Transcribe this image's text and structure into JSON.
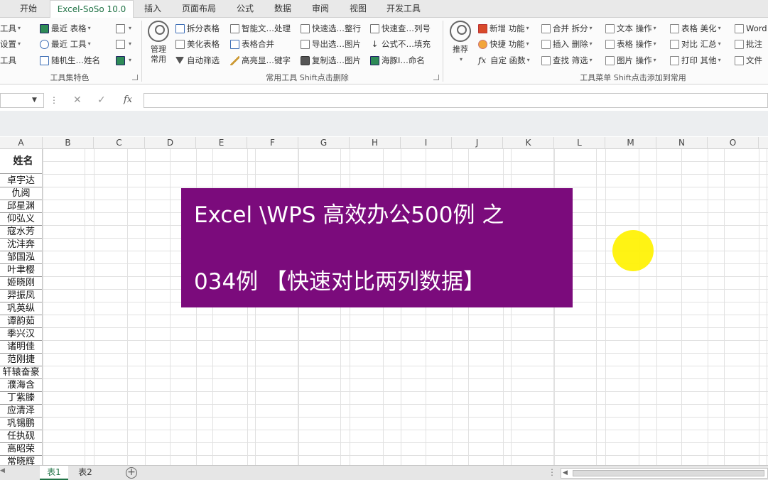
{
  "tabs": [
    {
      "label": "开始",
      "active": false
    },
    {
      "label": "Excel-SoSo 10.0",
      "active": true
    },
    {
      "label": "插入",
      "active": false
    },
    {
      "label": "页面布局",
      "active": false
    },
    {
      "label": "公式",
      "active": false
    },
    {
      "label": "数据",
      "active": false
    },
    {
      "label": "审阅",
      "active": false
    },
    {
      "label": "视图",
      "active": false
    },
    {
      "label": "开发工具",
      "active": false
    }
  ],
  "ribbon": {
    "left_partial": [
      "工具",
      "设置",
      "工具"
    ],
    "group1": {
      "items": [
        "最近 表格",
        "最近 工具",
        "随机生…姓名"
      ],
      "label": "工具集特色"
    },
    "manage_button": {
      "line1": "管理",
      "line2": "常用"
    },
    "group2": {
      "col1": [
        "拆分表格",
        "美化表格",
        "自动筛选"
      ],
      "col2": [
        "智能文…处理",
        "表格合并",
        "高亮显…键字"
      ],
      "col3": [
        "快速选…整行",
        "导出选…图片",
        "复制选…图片"
      ],
      "col4": [
        "快速查…列号",
        "公式不…填充",
        "海豚I…命名"
      ],
      "label": "常用工具 Shift点击删除"
    },
    "recommend_button": {
      "label": "推荐"
    },
    "group3": {
      "col1": [
        "新增 功能",
        "快捷 功能",
        "自定 函数"
      ],
      "col2": [
        "合并 拆分",
        "插入 删除",
        "查找 筛选"
      ],
      "col3": [
        "文本 操作",
        "表格 操作",
        "图片 操作"
      ],
      "col4": [
        "表格 美化",
        "对比 汇总",
        "打印 其他"
      ],
      "col5": [
        "Word",
        "批注",
        "文件"
      ],
      "label": "工具菜单 Shift点击添加到常用"
    }
  },
  "formula_bar": {
    "fx": "fx",
    "more": "⋮",
    "cancel": "✕",
    "confirm": "✓",
    "content": ""
  },
  "columns": [
    "A",
    "B",
    "C",
    "D",
    "E",
    "F",
    "G",
    "H",
    "I",
    "J",
    "K",
    "L",
    "M",
    "N",
    "O"
  ],
  "sheet": {
    "header": "姓名",
    "names": [
      "卓宇达",
      "仇阅",
      "邱星渊",
      "仰弘义",
      "寇水芳",
      "沈沣奔",
      "邹国泓",
      "叶聿樱",
      "姬晓刚",
      "羿振凤",
      "巩英纵",
      "谭韵茹",
      "季兴汉",
      "诸明佳",
      "范刚捷",
      "轩辕奋豪",
      "濮海含",
      "丁紫滕",
      "应清泽",
      "巩锡鹏",
      "任执砚",
      "高昭荣",
      "常晓辉"
    ]
  },
  "overlay": {
    "line1": "Excel \\WPS 高效办公500例 之",
    "line2": "034例 【快速对比两列数据】",
    "bg_color": "#7b0b7c"
  },
  "sheet_tabs": [
    {
      "label": "表1",
      "active": true
    },
    {
      "label": "表2",
      "active": false
    }
  ],
  "status": {
    "more": "⋮"
  }
}
